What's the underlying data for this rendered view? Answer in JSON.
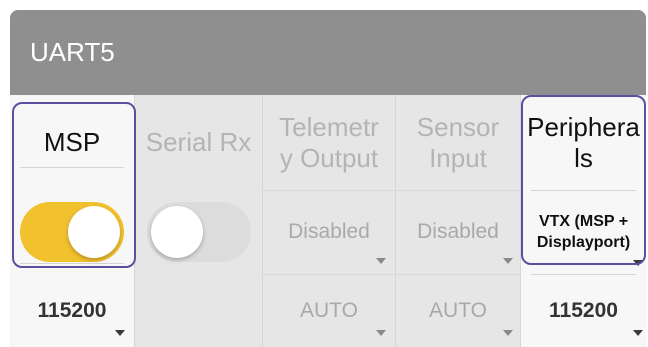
{
  "port": {
    "title": "UART5"
  },
  "columns": [
    {
      "id": "msp",
      "header": "MSP",
      "value": "",
      "baud": "115200",
      "enabled": true
    },
    {
      "id": "serial_rx",
      "header": "Serial Rx",
      "value": "",
      "baud": "",
      "enabled": false
    },
    {
      "id": "telemetry",
      "header": "Telemetr\ny Output",
      "value": "Disabled",
      "baud": "AUTO"
    },
    {
      "id": "sensor",
      "header": "Sensor\nInput",
      "value": "Disabled",
      "baud": "AUTO"
    },
    {
      "id": "peripherals",
      "header": "Periphera\nls",
      "value": "VTX (MSP +\nDisplayport)",
      "baud": "115200"
    }
  ],
  "colors": {
    "toggle_on": "#f2c12e",
    "toggle_off": "#dcdcdc",
    "header_bg": "#8f8f8f",
    "highlight": "#5b50a0"
  }
}
